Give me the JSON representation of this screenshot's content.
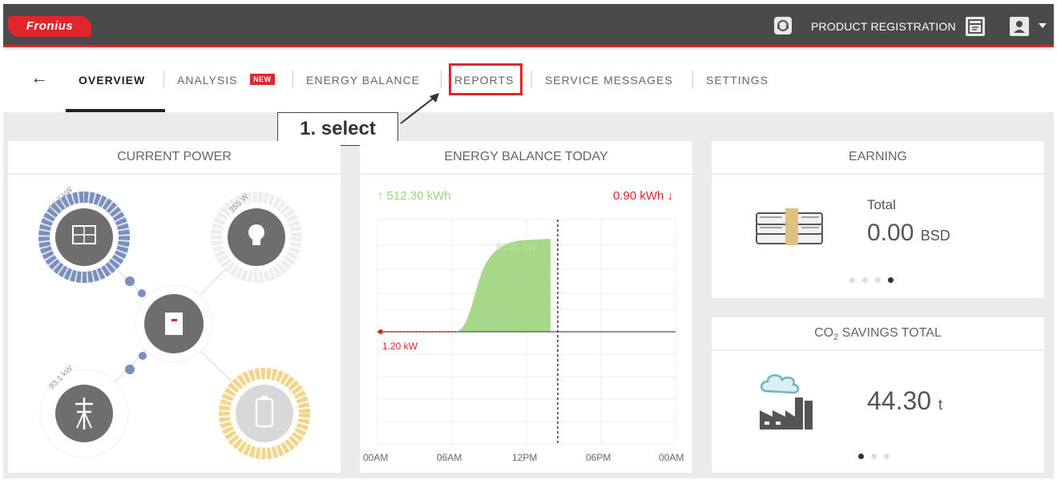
{
  "header": {
    "logo_text": "Fronius",
    "product_registration": "PRODUCT REGISTRATION"
  },
  "nav": {
    "items": [
      {
        "label": "OVERVIEW"
      },
      {
        "label": "ANALYSIS"
      },
      {
        "label": "ENERGY BALANCE"
      },
      {
        "label": "REPORTS"
      },
      {
        "label": "SERVICE MESSAGES"
      },
      {
        "label": "SETTINGS"
      }
    ],
    "analysis_badge": "NEW"
  },
  "callout": {
    "text": "1. select"
  },
  "current_power": {
    "title": "CURRENT POWER",
    "pv_label": "92.7 kW",
    "load_label": "355 W",
    "grid_label": "93.1 kW"
  },
  "energy_balance": {
    "title": "ENERGY BALANCE TODAY",
    "produced": "↑ 512.30 kWh",
    "consumed": "0.90 kWh ↓",
    "peak_label": "93.20 kW",
    "low_label": "1.20 kW",
    "x_ticks": [
      "00AM",
      "06AM",
      "12PM",
      "06PM",
      "00AM"
    ]
  },
  "earning": {
    "title": "EARNING",
    "total_label": "Total",
    "value": "0.00",
    "unit": "BSD"
  },
  "co2": {
    "title_main": "CO",
    "title_sub": "2",
    "title_rest": " SAVINGS TOTAL",
    "value": "44.30",
    "unit": "t"
  },
  "colors": {
    "brand_red": "#e0262a",
    "topbar": "#4a4a4a",
    "pv_blue": "#7b8fbf",
    "battery_yellow": "#f3d58a",
    "chart_green": "#9dd47a"
  }
}
